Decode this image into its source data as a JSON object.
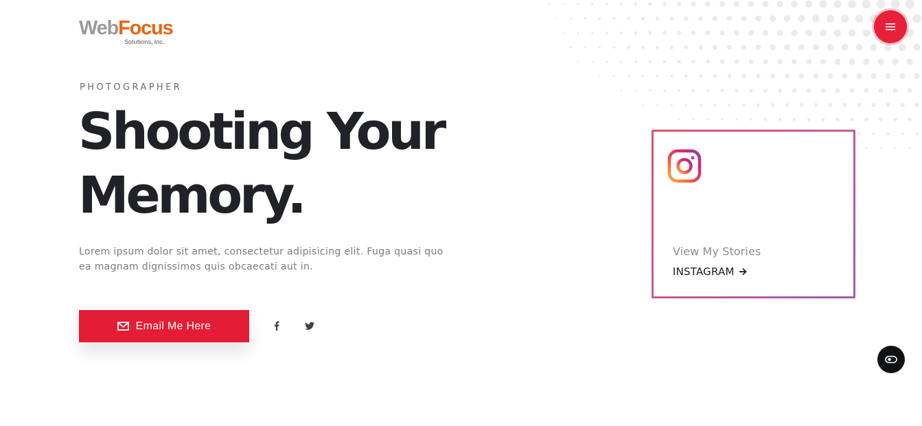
{
  "logo": {
    "part1": "Web",
    "part2": "Focus",
    "sub": "Solutions, Inc."
  },
  "header": {
    "menu_icon": "hamburger-icon"
  },
  "hero": {
    "eyebrow": "PHOTOGRAPHER",
    "title_line1": "Shooting Your",
    "title_line2": "Memory.",
    "description": "Lorem ipsum dolor sit amet, consectetur adipisicing elit. Fuga quasi quo ea magnam dignissimos quis obcaecati aut in.",
    "email_button": "Email Me Here",
    "email_icon": "envelope-icon",
    "social": [
      {
        "icon": "facebook-icon"
      },
      {
        "icon": "twitter-icon"
      }
    ]
  },
  "instagram_card": {
    "icon": "instagram-icon",
    "stories_text": "View My Stories",
    "link_label": "INSTAGRAM"
  },
  "floating_button": {
    "icon": "toggle-icon"
  },
  "colors": {
    "accent": "#e51c35",
    "heading": "#202227",
    "logo_gray": "#9a9a9a",
    "logo_orange": "#e8650f"
  }
}
